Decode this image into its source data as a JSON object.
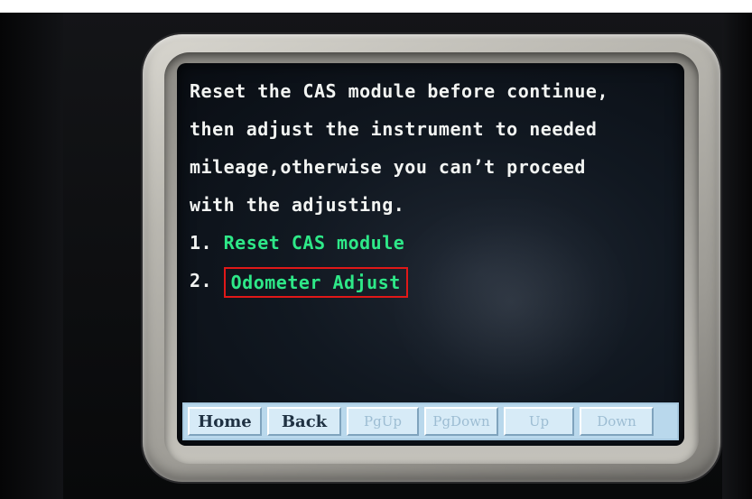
{
  "screen": {
    "message_lines": [
      "Reset the CAS module before continue,",
      "then adjust the instrument to needed",
      "mileage,otherwise you can’t proceed",
      "with the adjusting."
    ],
    "menu_items": [
      {
        "number": "1.",
        "label": "Reset CAS module",
        "selected": false
      },
      {
        "number": "2.",
        "label": "Odometer Adjust",
        "selected": true
      }
    ],
    "colors": {
      "text": "#f2f4f2",
      "menu_label": "#2ee888",
      "selection_border": "#e01818",
      "button_bar": "#b9d8ec"
    }
  },
  "button_bar": {
    "home": "Home",
    "back": "Back",
    "pgup": "PgUp",
    "pgdown": "PgDown",
    "up": "Up",
    "down": "Down"
  }
}
